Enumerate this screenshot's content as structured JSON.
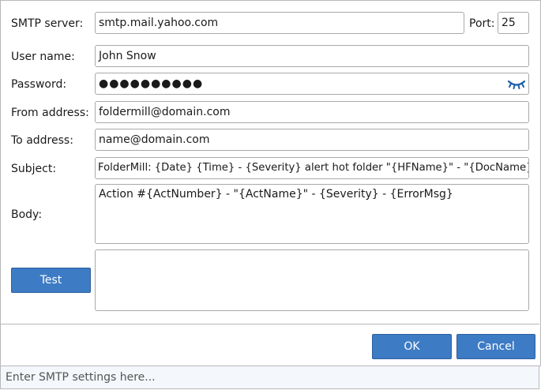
{
  "labels": {
    "smtp_server": "SMTP server:",
    "port": "Port:",
    "user_name": "User name:",
    "password": "Password:",
    "from_address": "From address:",
    "to_address": "To address:",
    "subject": "Subject:",
    "body": "Body:"
  },
  "values": {
    "smtp_server": "smtp.mail.yahoo.com",
    "port": "25",
    "user_name": "John Snow",
    "password_mask": "●●●●●●●●●●",
    "from_address": "foldermill@domain.com",
    "to_address": "name@domain.com",
    "subject": "FolderMill: {Date} {Time} - {Severity} alert hot folder \"{HFName}\" - \"{DocName}\"",
    "body": "Action #{ActNumber} - \"{ActName}\" - {Severity} - {ErrorMsg}",
    "test_output": ""
  },
  "icons": {
    "password_toggle": "eye-closed-icon"
  },
  "buttons": {
    "test": "Test",
    "ok": "OK",
    "cancel": "Cancel"
  },
  "status_bar": {
    "placeholder": "Enter SMTP settings here..."
  },
  "colors": {
    "accent": "#3d7bc4",
    "icon": "#1f5fa8"
  }
}
